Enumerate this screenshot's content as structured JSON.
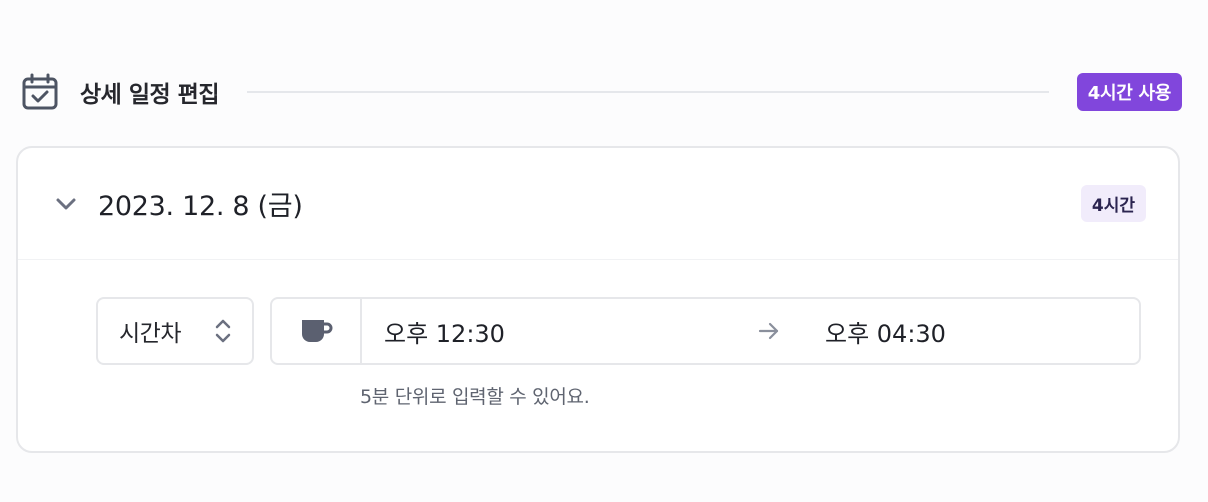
{
  "header": {
    "icon": "calendar-check-icon",
    "title": "상세 일정 편집",
    "usage_badge": "4시간 사용"
  },
  "day": {
    "toggle_icon": "chevron-down-icon",
    "date": "2023. 12. 8 (금)",
    "hours_badge": "4시간"
  },
  "entry": {
    "type_select": {
      "value": "시간차",
      "icon": "updown-chevron-icon"
    },
    "category_icon": "coffee-cup-icon",
    "start_time": "오후 12:30",
    "arrow_icon": "arrow-right-icon",
    "end_time": "오후 04:30",
    "hint": "5분 단위로 입력할 수 있어요."
  },
  "colors": {
    "accent": "#8146dc",
    "badge_bg": "#f1ecfb",
    "border": "#e6e7ea",
    "icon_gray": "#5b6070"
  }
}
